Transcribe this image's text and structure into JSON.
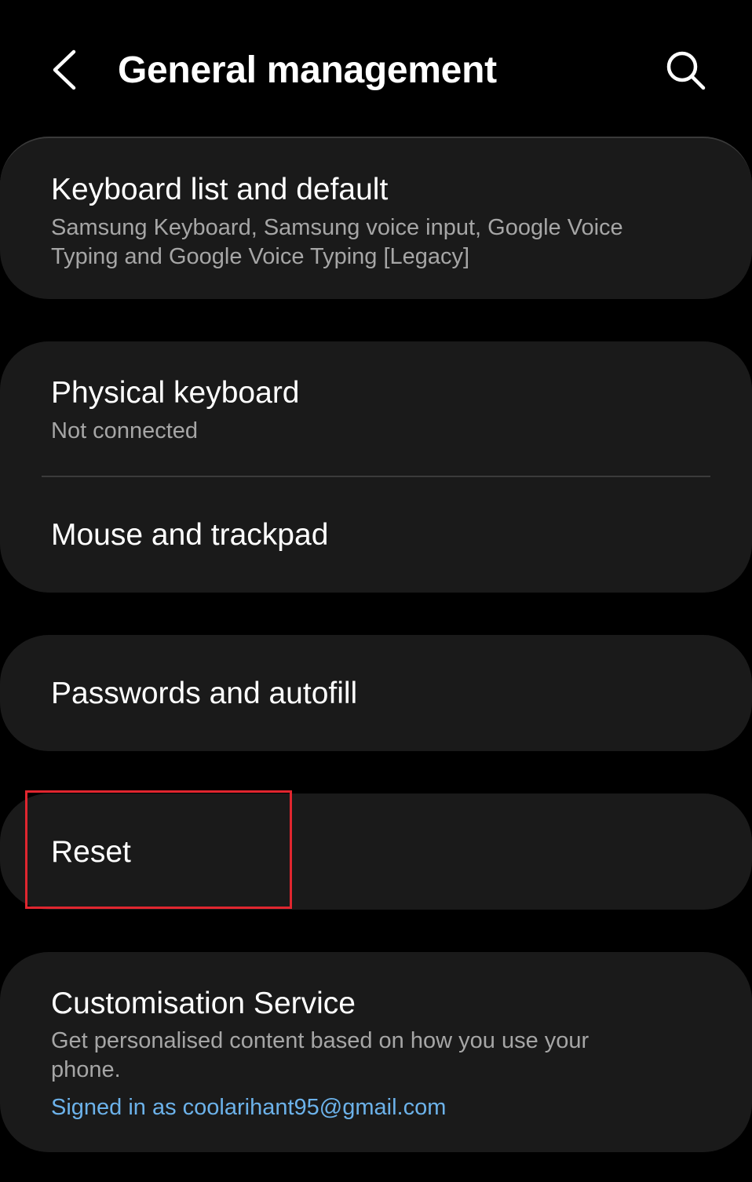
{
  "header": {
    "title": "General management",
    "back_icon": "chevron-left-icon",
    "search_icon": "search-icon"
  },
  "items": {
    "keyboard_list": {
      "title": "Keyboard list and default",
      "subtitle": "Samsung Keyboard, Samsung voice input, Google Voice Typing and Google Voice Typing [Legacy]"
    },
    "physical_keyboard": {
      "title": "Physical keyboard",
      "subtitle": "Not connected"
    },
    "mouse_trackpad": {
      "title": "Mouse and trackpad"
    },
    "passwords_autofill": {
      "title": "Passwords and autofill"
    },
    "reset": {
      "title": "Reset"
    },
    "customisation_service": {
      "title": "Customisation Service",
      "subtitle": "Get personalised content based on how you use your phone.",
      "account": "Signed in as coolarihant95@gmail.com"
    }
  },
  "colors": {
    "background": "#000000",
    "card": "#1a1a1a",
    "subtitle": "#a6a6a6",
    "link": "#6cb2ea",
    "highlight": "#e0262f"
  }
}
